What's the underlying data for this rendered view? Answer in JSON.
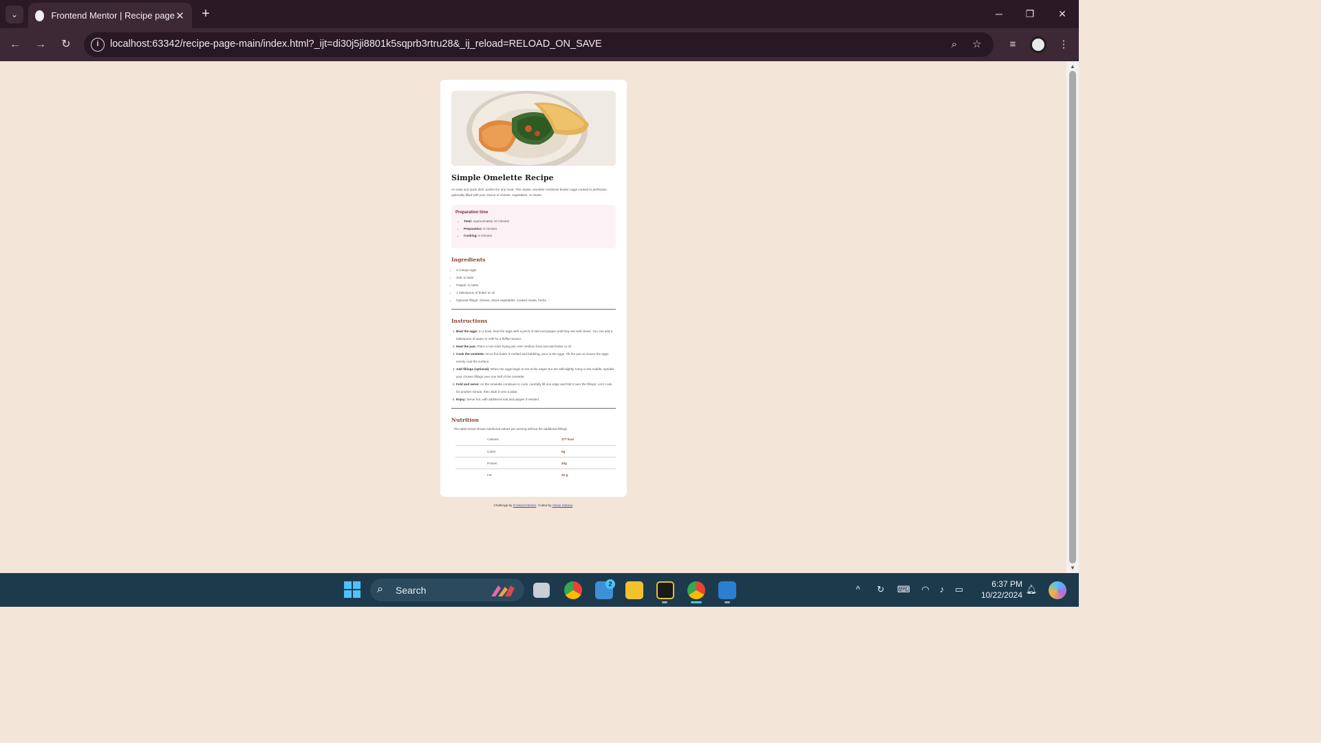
{
  "browser": {
    "tab_title": "Frontend Mentor | Recipe page",
    "url": "localhost:63342/recipe-page-main/index.html?_ijt=di30j5ji8801k5sqprb3rtru28&_ij_reload=RELOAD_ON_SAVE"
  },
  "recipe": {
    "title": "Simple Omelette Recipe",
    "intro": "An easy and quick dish, perfect for any meal. This classic omelette combines beaten eggs cooked to perfection, optionally filled with your choice of cheese, vegetables, or meats.",
    "preparation": {
      "title": "Preparation time",
      "items": [
        {
          "label": "Total:",
          "value": "Approximately 10 minutes"
        },
        {
          "label": "Preparation:",
          "value": "5 minutes"
        },
        {
          "label": "Cooking:",
          "value": "5 minutes"
        }
      ]
    },
    "ingredients": {
      "title": "Ingredients",
      "items": [
        "2-3 large eggs",
        "Salt, to taste",
        "Pepper, to taste",
        "1 tablespoon of butter or oil",
        "Optional fillings: cheese, diced vegetables, cooked meats, herbs"
      ]
    },
    "instructions": {
      "title": "Instructions",
      "items": [
        {
          "label": "Beat the eggs:",
          "text": "In a bowl, beat the eggs with a pinch of salt and pepper until they are well mixed. You can add a tablespoon of water or milk for a fluffier texture."
        },
        {
          "label": "Heat the pan:",
          "text": "Place a non-stick frying pan over medium heat and add butter or oil."
        },
        {
          "label": "Cook the omelette:",
          "text": "Once the butter is melted and bubbling, pour in the eggs. Tilt the pan to ensure the eggs evenly coat the surface."
        },
        {
          "label": "Add fillings (optional):",
          "text": "When the eggs begin to set at the edges but are still slightly runny in the middle, sprinkle your chosen fillings over one half of the omelette."
        },
        {
          "label": "Fold and serve:",
          "text": "As the omelette continues to cook, carefully lift one edge and fold it over the fillings. Let it cook for another minute, then slide it onto a plate."
        },
        {
          "label": "Enjoy:",
          "text": "Serve hot, with additional salt and pepper if needed."
        }
      ]
    },
    "nutrition": {
      "title": "Nutrition",
      "intro": "The table below shows nutritional values per serving without the additional fillings.",
      "rows": [
        {
          "label": "Calories",
          "value": "277 kcal"
        },
        {
          "label": "Carbs",
          "value": "0g"
        },
        {
          "label": "Protein",
          "value": "20g"
        },
        {
          "label": "Fat",
          "value": "22 g"
        }
      ]
    }
  },
  "attribution": {
    "prefix": "Challenge by",
    "link1": "Frontend Mentor",
    "middle": ". Coded by",
    "link2": "Almas Sultana",
    "suffix": "."
  },
  "taskbar": {
    "search_label": "Search",
    "mail_badge": "2",
    "time": "6:37 PM",
    "date": "10/22/2024"
  },
  "icons": {
    "accent": "#4cc2ff",
    "heading_color": "#854632",
    "prep_title_color": "#7a284b"
  }
}
